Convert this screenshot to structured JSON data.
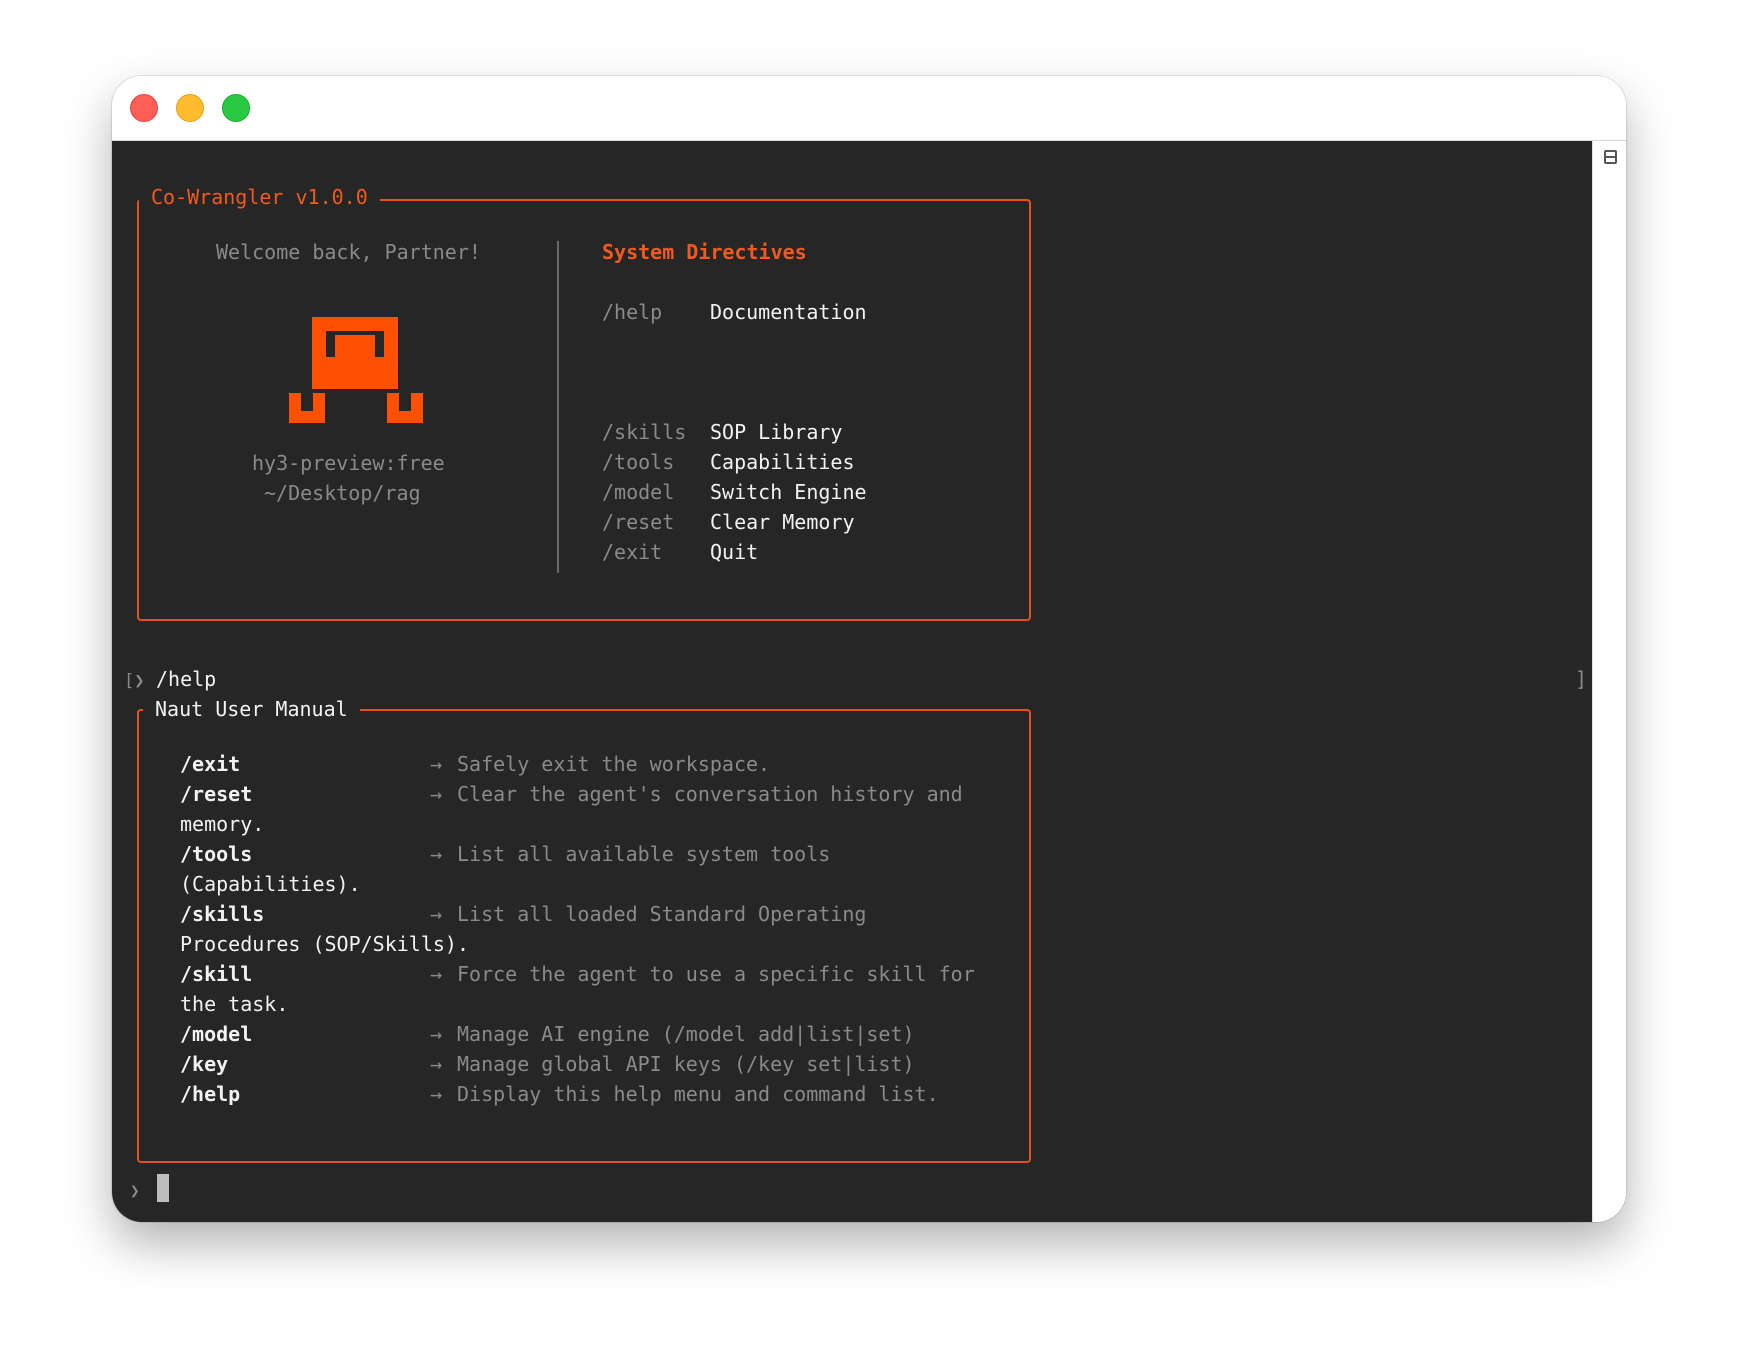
{
  "window": {
    "controls": [
      "close",
      "minimize",
      "maximize"
    ]
  },
  "banner": {
    "title": "Co-Wrangler v1.0.0",
    "welcome": "Welcome back, Partner!",
    "model": "hy3-preview:free",
    "path": "~/Desktop/rag",
    "directives_heading": "System Directives",
    "directives": [
      {
        "cmd": "/help",
        "desc": "Documentation"
      },
      {
        "cmd": "/skills",
        "desc": "SOP Library"
      },
      {
        "cmd": "/tools",
        "desc": "Capabilities"
      },
      {
        "cmd": "/model",
        "desc": "Switch Engine"
      },
      {
        "cmd": "/reset",
        "desc": "Clear Memory"
      },
      {
        "cmd": "/exit",
        "desc": "Quit"
      }
    ]
  },
  "prompt_line": {
    "marker": "[❯",
    "command": "/help",
    "right_bracket": "]"
  },
  "manual": {
    "title": "Naut User Manual",
    "arrow": "→",
    "entries": [
      {
        "cmd": "/exit",
        "desc": "Safely exit the workspace.",
        "cont": ""
      },
      {
        "cmd": "/reset",
        "desc": "Clear the agent's conversation history and",
        "cont": "memory."
      },
      {
        "cmd": "/tools",
        "desc": "List all available system tools",
        "cont": "(Capabilities)."
      },
      {
        "cmd": "/skills",
        "desc": "List all loaded Standard Operating",
        "cont": "Procedures (SOP/Skills)."
      },
      {
        "cmd": "/skill",
        "desc": "Force the agent to use a specific skill for",
        "cont": "the task."
      },
      {
        "cmd": "/model",
        "desc": "Manage AI engine (/model add|list|set)",
        "cont": ""
      },
      {
        "cmd": "/key",
        "desc": "Manage global API keys (/key set|list)",
        "cont": ""
      },
      {
        "cmd": "/help",
        "desc": "Display this help menu and command list.",
        "cont": ""
      }
    ]
  },
  "input": {
    "prompt": "❯",
    "value": ""
  },
  "colors": {
    "accent": "#f25a1f",
    "background": "#262626",
    "robot": "#ff4f00"
  }
}
